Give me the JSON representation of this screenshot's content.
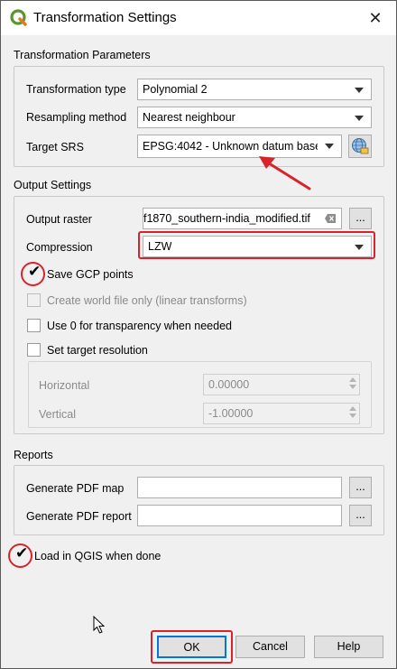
{
  "window": {
    "title": "Transformation Settings",
    "close_symbol": "✕"
  },
  "transformation_parameters": {
    "group_title": "Transformation Parameters",
    "transformation_type_label": "Transformation type",
    "transformation_type_value": "Polynomial 2",
    "resampling_method_label": "Resampling method",
    "resampling_method_value": "Nearest neighbour",
    "target_srs_label": "Target SRS",
    "target_srs_value": "EPSG:4042 - Unknown datum base"
  },
  "output_settings": {
    "group_title": "Output Settings",
    "output_raster_label": "Output raster",
    "output_raster_value": "f1870_southern-india_modified.tif",
    "browse_label": "...",
    "compression_label": "Compression",
    "compression_value": "LZW",
    "save_gcp_label": "Save GCP points",
    "save_gcp_checked": true,
    "world_file_label": "Create world file only (linear transforms)",
    "world_file_enabled": false,
    "use_zero_label": "Use 0 for transparency when needed",
    "set_resolution_label": "Set target resolution",
    "horizontal_label": "Horizontal",
    "horizontal_value": "0.00000",
    "vertical_label": "Vertical",
    "vertical_value": "-1.00000"
  },
  "reports": {
    "group_title": "Reports",
    "pdf_map_label": "Generate PDF map",
    "pdf_map_value": "",
    "pdf_report_label": "Generate PDF report",
    "pdf_report_value": "",
    "browse_label": "..."
  },
  "load_in_qgis": {
    "label": "Load in QGIS when done",
    "checked": true
  },
  "buttons": {
    "ok": "OK",
    "cancel": "Cancel",
    "help": "Help"
  },
  "annotation_color": "#d9232b",
  "icons": [
    "qgis-logo-icon",
    "close-icon",
    "globe-srs-icon",
    "clear-icon",
    "dropdown-arrow-icon",
    "checkmark-icon",
    "arrow-annotation-icon",
    "mouse-cursor-icon"
  ]
}
